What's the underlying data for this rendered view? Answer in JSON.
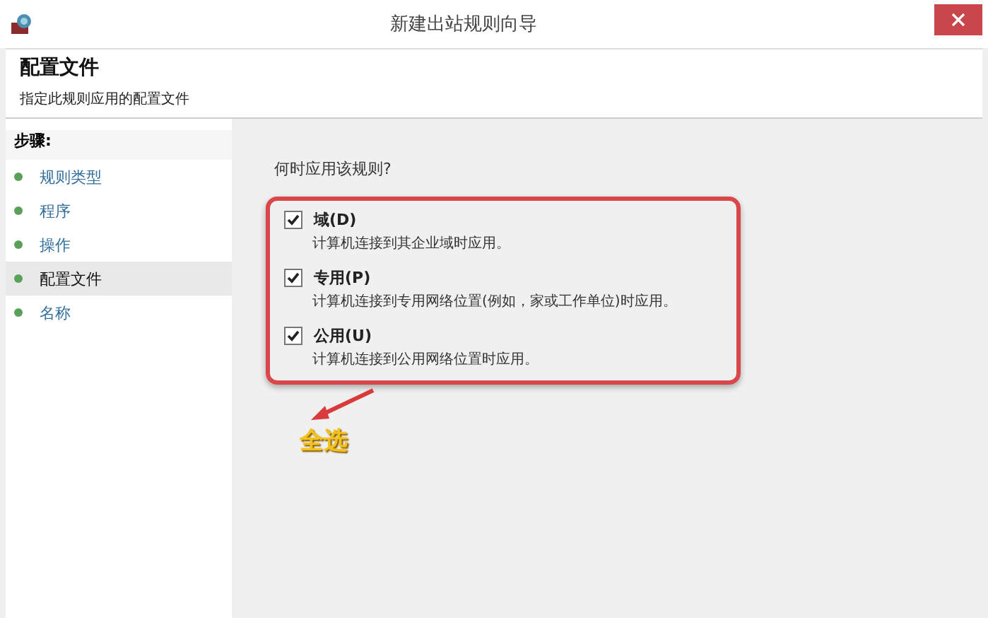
{
  "window": {
    "title": "新建出站规则向导"
  },
  "header": {
    "title": "配置文件",
    "subtitle": "指定此规则应用的配置文件"
  },
  "sidebar": {
    "heading": "步骤:",
    "items": [
      {
        "label": "规则类型",
        "selected": false
      },
      {
        "label": "程序",
        "selected": false
      },
      {
        "label": "操作",
        "selected": false
      },
      {
        "label": "配置文件",
        "selected": true
      },
      {
        "label": "名称",
        "selected": false
      }
    ]
  },
  "content": {
    "question": "何时应用该规则?",
    "options": [
      {
        "label": "域(D)",
        "description": "计算机连接到其企业域时应用。",
        "checked": true
      },
      {
        "label": "专用(P)",
        "description": "计算机连接到专用网络位置(例如，家或工作单位)时应用。",
        "checked": true
      },
      {
        "label": "公用(U)",
        "description": "计算机连接到公用网络位置时应用。",
        "checked": true
      }
    ]
  },
  "annotation": {
    "text": "全选"
  }
}
